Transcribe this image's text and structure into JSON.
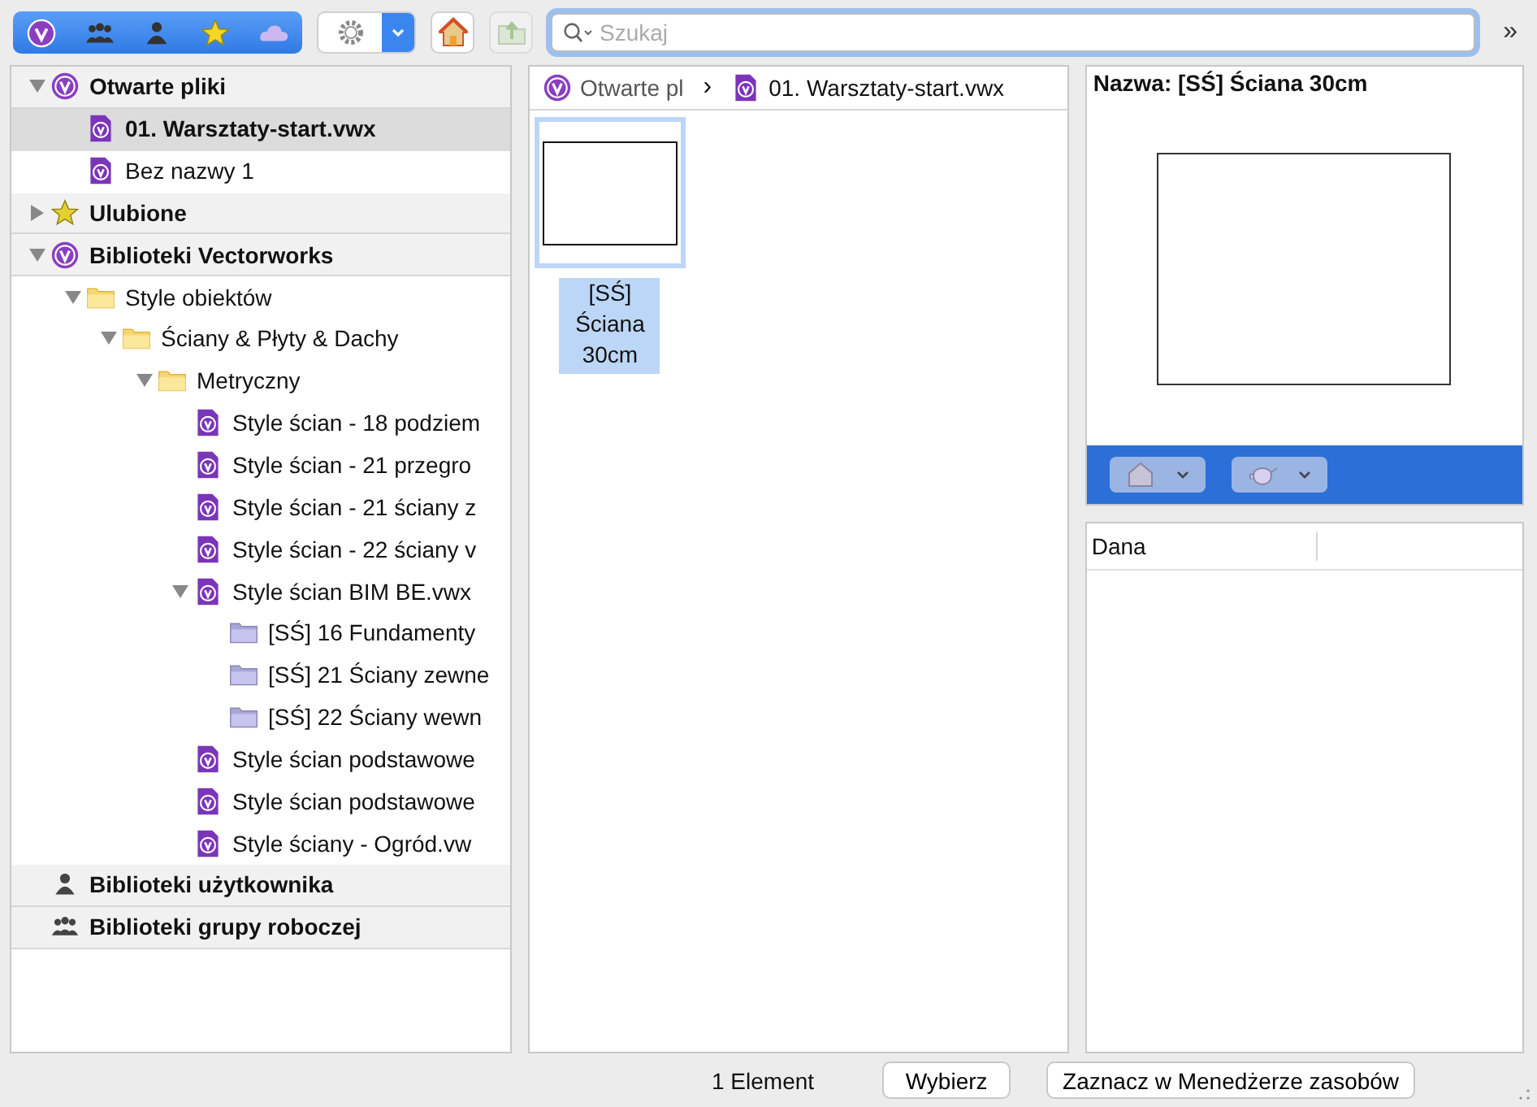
{
  "toolbar": {
    "library_tabs": [
      {
        "kind": "vectorworks"
      },
      {
        "kind": "group"
      },
      {
        "kind": "user"
      },
      {
        "kind": "favorite"
      },
      {
        "kind": "cloud"
      }
    ],
    "search": {
      "placeholder": "Szukaj"
    },
    "overflow": "»"
  },
  "tree": [
    {
      "label": "Otwarte pliki",
      "kind": "vectorworks",
      "expanded": true,
      "children": [
        {
          "label": "01. Warsztaty-start.vwx",
          "kind": "file",
          "selected": true
        },
        {
          "label": "Bez nazwy 1",
          "kind": "file",
          "selected": false
        }
      ]
    },
    {
      "label": "Ulubione",
      "kind": "favorite",
      "expanded": false
    },
    {
      "label": "Biblioteki Vectorworks",
      "kind": "vectorworks",
      "expanded": true,
      "children": [
        {
          "label": "Style obiektów",
          "kind": "folder",
          "expanded": true,
          "children": [
            {
              "label": "Ściany & Płyty & Dachy",
              "kind": "folder",
              "expanded": true,
              "children": [
                {
                  "label": "Metryczny",
                  "kind": "folder",
                  "expanded": true,
                  "children": [
                    {
                      "label": "Style ścian - 18 podziem",
                      "kind": "file",
                      "selected": false
                    },
                    {
                      "label": "Style ścian - 21 przegro",
                      "kind": "file",
                      "selected": false
                    },
                    {
                      "label": "Style ścian - 21 ściany z",
                      "kind": "file",
                      "selected": false
                    },
                    {
                      "label": "Style ścian - 22 ściany v",
                      "kind": "file",
                      "selected": false
                    },
                    {
                      "label": "Style ścian BIM BE.vwx",
                      "kind": "file",
                      "expanded": true,
                      "children": [
                        {
                          "label": "[SŚ] 16 Fundamenty",
                          "kind": "subfolder",
                          "selected": false
                        },
                        {
                          "label": "[SŚ] 21 Ściany zewne",
                          "kind": "subfolder",
                          "selected": false
                        },
                        {
                          "label": "[SŚ] 22 Ściany wewn",
                          "kind": "subfolder",
                          "selected": false
                        }
                      ]
                    },
                    {
                      "label": "Style ścian podstawowe",
                      "kind": "file",
                      "selected": false
                    },
                    {
                      "label": "Style ścian podstawowe",
                      "kind": "file",
                      "selected": false
                    },
                    {
                      "label": "Style ściany - Ogród.vw",
                      "kind": "file",
                      "selected": false
                    }
                  ]
                }
              ]
            }
          ]
        }
      ]
    },
    {
      "label": "Biblioteki użytkownika",
      "kind": "user"
    },
    {
      "label": "Biblioteki grupy roboczej",
      "kind": "group"
    }
  ],
  "breadcrumb": [
    {
      "label": "Otwarte pl",
      "kind": "vectorworks"
    },
    {
      "label": "01. Warsztaty-start.vwx",
      "kind": "file"
    }
  ],
  "breadcrumb_separator": "›",
  "resources": [
    {
      "label": "[SŚ] Ściana 30cm",
      "selected": true
    }
  ],
  "preview": {
    "title": "Nazwa: [SŚ] Ściana 30cm"
  },
  "info_table": {
    "columns": [
      "Dana"
    ]
  },
  "footer": {
    "count": "1 Element",
    "buttons": [
      "Wybierz",
      "Zaznacz w Menedżerze zasobów"
    ]
  }
}
